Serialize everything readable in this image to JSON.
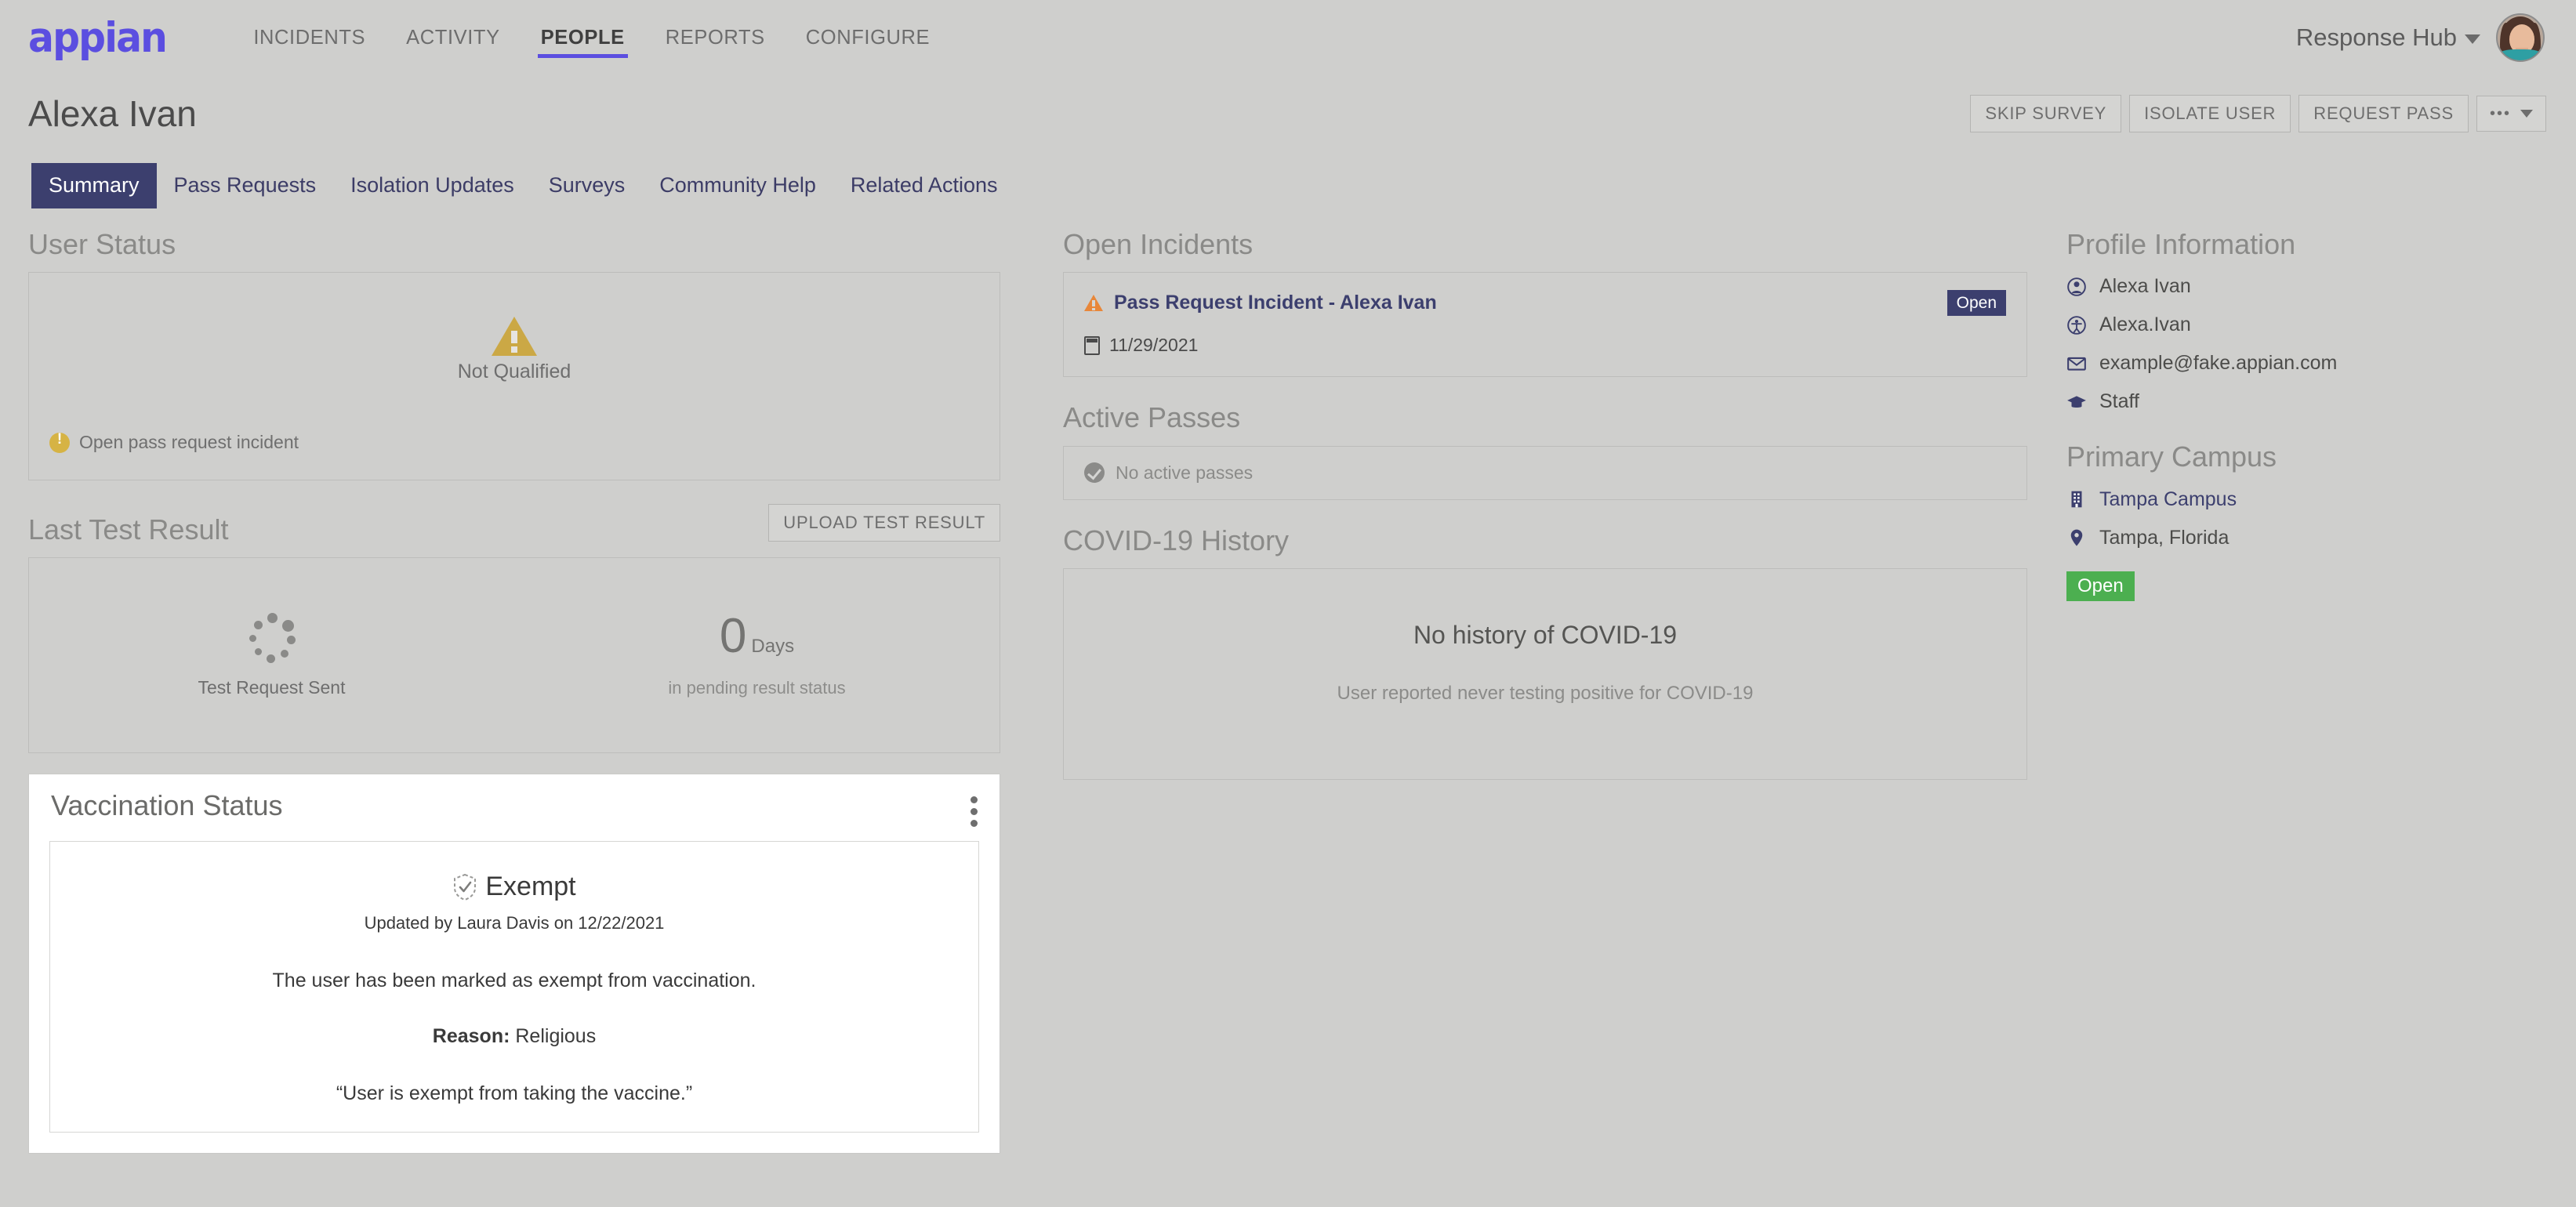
{
  "header": {
    "logo_text": "appian",
    "nav_items": [
      {
        "label": "INCIDENTS",
        "active": false
      },
      {
        "label": "ACTIVITY",
        "active": false
      },
      {
        "label": "PEOPLE",
        "active": true
      },
      {
        "label": "REPORTS",
        "active": false
      },
      {
        "label": "CONFIGURE",
        "active": false
      }
    ],
    "site_name": "Response Hub",
    "accent_color": "#5b4ee0"
  },
  "page": {
    "title": "Alexa Ivan",
    "actions": {
      "skip_survey": "SKIP SURVEY",
      "isolate_user": "ISOLATE USER",
      "request_pass": "REQUEST PASS",
      "more": "•••"
    },
    "tabs": [
      {
        "label": "Summary",
        "active": true
      },
      {
        "label": "Pass Requests",
        "active": false
      },
      {
        "label": "Isolation Updates",
        "active": false
      },
      {
        "label": "Surveys",
        "active": false
      },
      {
        "label": "Community Help",
        "active": false
      },
      {
        "label": "Related Actions",
        "active": false
      }
    ]
  },
  "user_status": {
    "title": "User Status",
    "status_label": "Not Qualified",
    "status_icon": "warning-triangle-icon",
    "note": "Open pass request incident",
    "note_icon": "circle-exclamation-icon",
    "warning_color": "#cba845"
  },
  "last_test_result": {
    "title": "Last Test Result",
    "upload_button": "UPLOAD TEST RESULT",
    "test_state": "Test Request Sent",
    "test_state_icon": "spinner-icon",
    "days_value": "0",
    "days_unit": "Days",
    "days_sub": "in pending result status"
  },
  "vaccination": {
    "title": "Vaccination Status",
    "menu_icon": "kebab-menu-icon",
    "status": "Exempt",
    "status_icon": "shield-check-icon",
    "updated": "Updated by Laura Davis on 12/22/2021",
    "description": "The user has been marked as exempt from vaccination.",
    "reason_label": "Reason:",
    "reason_value": "Religious",
    "quote": "“User is exempt from taking the vaccine.”"
  },
  "open_incidents": {
    "title": "Open Incidents",
    "items": [
      {
        "name": "Pass Request Incident - Alexa Ivan",
        "icon": "warning-triangle-icon",
        "status": "Open",
        "date": "11/29/2021",
        "date_icon": "calendar-icon",
        "status_color": "#3c3f6e"
      }
    ]
  },
  "active_passes": {
    "title": "Active Passes",
    "empty_text": "No active passes",
    "empty_icon": "check-circle-icon"
  },
  "covid_history": {
    "title": "COVID-19 History",
    "headline": "No history of COVID-19",
    "subtext": "User reported never testing positive for COVID-19"
  },
  "profile": {
    "title": "Profile Information",
    "rows": [
      {
        "icon": "user-icon",
        "value": "Alexa Ivan",
        "link": false
      },
      {
        "icon": "id-badge-icon",
        "value": "Alexa.Ivan",
        "link": false
      },
      {
        "icon": "envelope-icon",
        "value": "example@fake.appian.com",
        "link": false
      },
      {
        "icon": "graduation-cap-icon",
        "value": "Staff",
        "link": false
      }
    ]
  },
  "campus": {
    "title": "Primary Campus",
    "name": "Tampa Campus",
    "name_icon": "building-icon",
    "location": "Tampa, Florida",
    "location_icon": "map-pin-icon",
    "status": "Open",
    "status_color": "#4caf50"
  }
}
